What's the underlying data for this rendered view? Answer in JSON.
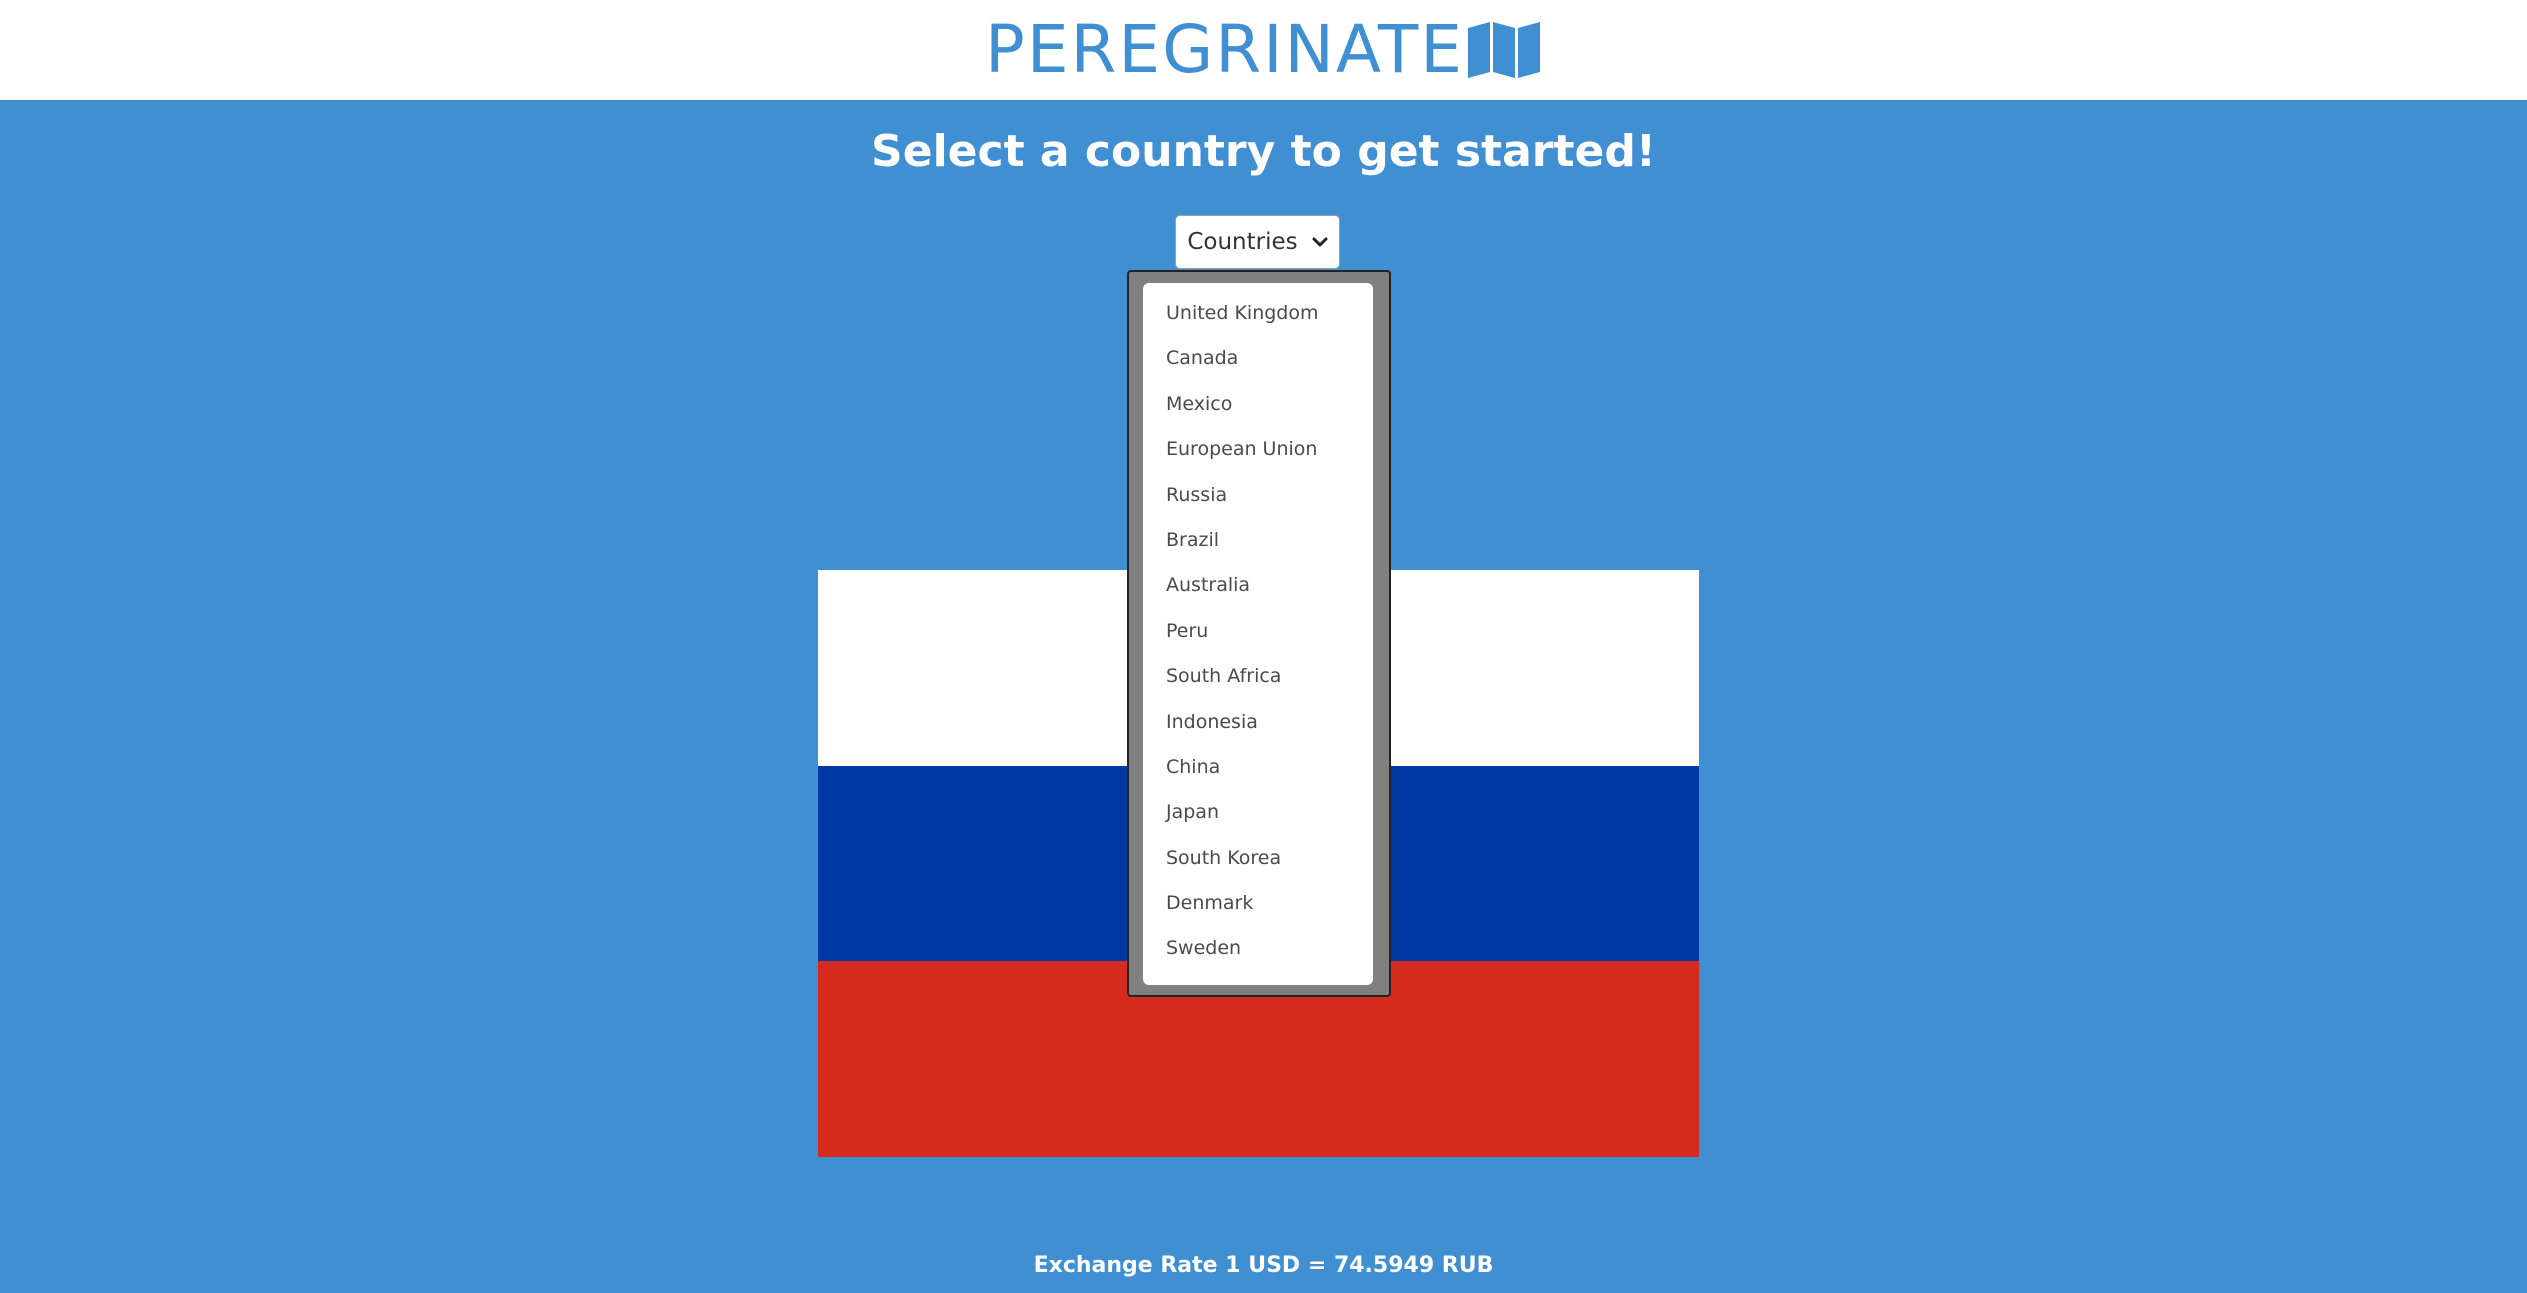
{
  "header": {
    "logo_text": "PEREGRINATE",
    "logo_icon": "map-icon"
  },
  "main": {
    "headline": "Select a country to get started!",
    "dropdown": {
      "label": "Countries",
      "icon": "chevron-down-icon",
      "items": [
        {
          "label": "United Kingdom"
        },
        {
          "label": "Canada"
        },
        {
          "label": "Mexico"
        },
        {
          "label": "European Union"
        },
        {
          "label": "Russia"
        },
        {
          "label": "Brazil"
        },
        {
          "label": "Australia"
        },
        {
          "label": "Peru"
        },
        {
          "label": "South Africa"
        },
        {
          "label": "Indonesia"
        },
        {
          "label": "China"
        },
        {
          "label": "Japan"
        },
        {
          "label": "South Korea"
        },
        {
          "label": "Denmark"
        },
        {
          "label": "Sweden"
        }
      ]
    },
    "flag": {
      "stripes": [
        "#ffffff",
        "#0039a6",
        "#d52b1e"
      ]
    },
    "exchange_rate": "Exchange Rate 1 USD = 74.5949 RUB"
  },
  "colors": {
    "background": "#3f8fd2",
    "header_bg": "#ffffff",
    "accent": "#3f8fd2"
  }
}
